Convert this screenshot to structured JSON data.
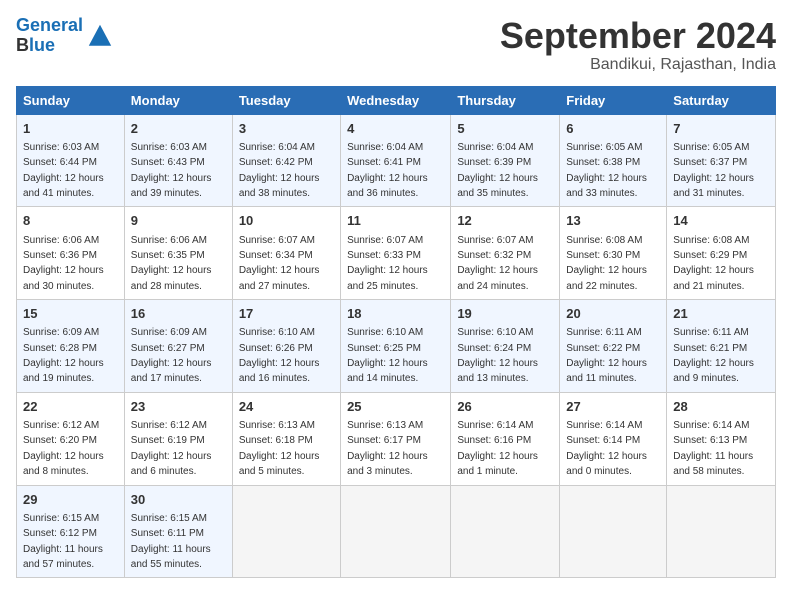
{
  "header": {
    "logo_line1": "General",
    "logo_line2": "Blue",
    "month_title": "September 2024",
    "location": "Bandikui, Rajasthan, India"
  },
  "weekdays": [
    "Sunday",
    "Monday",
    "Tuesday",
    "Wednesday",
    "Thursday",
    "Friday",
    "Saturday"
  ],
  "weeks": [
    [
      {
        "day": "1",
        "sunrise": "Sunrise: 6:03 AM",
        "sunset": "Sunset: 6:44 PM",
        "daylight": "Daylight: 12 hours and 41 minutes."
      },
      {
        "day": "2",
        "sunrise": "Sunrise: 6:03 AM",
        "sunset": "Sunset: 6:43 PM",
        "daylight": "Daylight: 12 hours and 39 minutes."
      },
      {
        "day": "3",
        "sunrise": "Sunrise: 6:04 AM",
        "sunset": "Sunset: 6:42 PM",
        "daylight": "Daylight: 12 hours and 38 minutes."
      },
      {
        "day": "4",
        "sunrise": "Sunrise: 6:04 AM",
        "sunset": "Sunset: 6:41 PM",
        "daylight": "Daylight: 12 hours and 36 minutes."
      },
      {
        "day": "5",
        "sunrise": "Sunrise: 6:04 AM",
        "sunset": "Sunset: 6:39 PM",
        "daylight": "Daylight: 12 hours and 35 minutes."
      },
      {
        "day": "6",
        "sunrise": "Sunrise: 6:05 AM",
        "sunset": "Sunset: 6:38 PM",
        "daylight": "Daylight: 12 hours and 33 minutes."
      },
      {
        "day": "7",
        "sunrise": "Sunrise: 6:05 AM",
        "sunset": "Sunset: 6:37 PM",
        "daylight": "Daylight: 12 hours and 31 minutes."
      }
    ],
    [
      {
        "day": "8",
        "sunrise": "Sunrise: 6:06 AM",
        "sunset": "Sunset: 6:36 PM",
        "daylight": "Daylight: 12 hours and 30 minutes."
      },
      {
        "day": "9",
        "sunrise": "Sunrise: 6:06 AM",
        "sunset": "Sunset: 6:35 PM",
        "daylight": "Daylight: 12 hours and 28 minutes."
      },
      {
        "day": "10",
        "sunrise": "Sunrise: 6:07 AM",
        "sunset": "Sunset: 6:34 PM",
        "daylight": "Daylight: 12 hours and 27 minutes."
      },
      {
        "day": "11",
        "sunrise": "Sunrise: 6:07 AM",
        "sunset": "Sunset: 6:33 PM",
        "daylight": "Daylight: 12 hours and 25 minutes."
      },
      {
        "day": "12",
        "sunrise": "Sunrise: 6:07 AM",
        "sunset": "Sunset: 6:32 PM",
        "daylight": "Daylight: 12 hours and 24 minutes."
      },
      {
        "day": "13",
        "sunrise": "Sunrise: 6:08 AM",
        "sunset": "Sunset: 6:30 PM",
        "daylight": "Daylight: 12 hours and 22 minutes."
      },
      {
        "day": "14",
        "sunrise": "Sunrise: 6:08 AM",
        "sunset": "Sunset: 6:29 PM",
        "daylight": "Daylight: 12 hours and 21 minutes."
      }
    ],
    [
      {
        "day": "15",
        "sunrise": "Sunrise: 6:09 AM",
        "sunset": "Sunset: 6:28 PM",
        "daylight": "Daylight: 12 hours and 19 minutes."
      },
      {
        "day": "16",
        "sunrise": "Sunrise: 6:09 AM",
        "sunset": "Sunset: 6:27 PM",
        "daylight": "Daylight: 12 hours and 17 minutes."
      },
      {
        "day": "17",
        "sunrise": "Sunrise: 6:10 AM",
        "sunset": "Sunset: 6:26 PM",
        "daylight": "Daylight: 12 hours and 16 minutes."
      },
      {
        "day": "18",
        "sunrise": "Sunrise: 6:10 AM",
        "sunset": "Sunset: 6:25 PM",
        "daylight": "Daylight: 12 hours and 14 minutes."
      },
      {
        "day": "19",
        "sunrise": "Sunrise: 6:10 AM",
        "sunset": "Sunset: 6:24 PM",
        "daylight": "Daylight: 12 hours and 13 minutes."
      },
      {
        "day": "20",
        "sunrise": "Sunrise: 6:11 AM",
        "sunset": "Sunset: 6:22 PM",
        "daylight": "Daylight: 12 hours and 11 minutes."
      },
      {
        "day": "21",
        "sunrise": "Sunrise: 6:11 AM",
        "sunset": "Sunset: 6:21 PM",
        "daylight": "Daylight: 12 hours and 9 minutes."
      }
    ],
    [
      {
        "day": "22",
        "sunrise": "Sunrise: 6:12 AM",
        "sunset": "Sunset: 6:20 PM",
        "daylight": "Daylight: 12 hours and 8 minutes."
      },
      {
        "day": "23",
        "sunrise": "Sunrise: 6:12 AM",
        "sunset": "Sunset: 6:19 PM",
        "daylight": "Daylight: 12 hours and 6 minutes."
      },
      {
        "day": "24",
        "sunrise": "Sunrise: 6:13 AM",
        "sunset": "Sunset: 6:18 PM",
        "daylight": "Daylight: 12 hours and 5 minutes."
      },
      {
        "day": "25",
        "sunrise": "Sunrise: 6:13 AM",
        "sunset": "Sunset: 6:17 PM",
        "daylight": "Daylight: 12 hours and 3 minutes."
      },
      {
        "day": "26",
        "sunrise": "Sunrise: 6:14 AM",
        "sunset": "Sunset: 6:16 PM",
        "daylight": "Daylight: 12 hours and 1 minute."
      },
      {
        "day": "27",
        "sunrise": "Sunrise: 6:14 AM",
        "sunset": "Sunset: 6:14 PM",
        "daylight": "Daylight: 12 hours and 0 minutes."
      },
      {
        "day": "28",
        "sunrise": "Sunrise: 6:14 AM",
        "sunset": "Sunset: 6:13 PM",
        "daylight": "Daylight: 11 hours and 58 minutes."
      }
    ],
    [
      {
        "day": "29",
        "sunrise": "Sunrise: 6:15 AM",
        "sunset": "Sunset: 6:12 PM",
        "daylight": "Daylight: 11 hours and 57 minutes."
      },
      {
        "day": "30",
        "sunrise": "Sunrise: 6:15 AM",
        "sunset": "Sunset: 6:11 PM",
        "daylight": "Daylight: 11 hours and 55 minutes."
      },
      null,
      null,
      null,
      null,
      null
    ]
  ]
}
